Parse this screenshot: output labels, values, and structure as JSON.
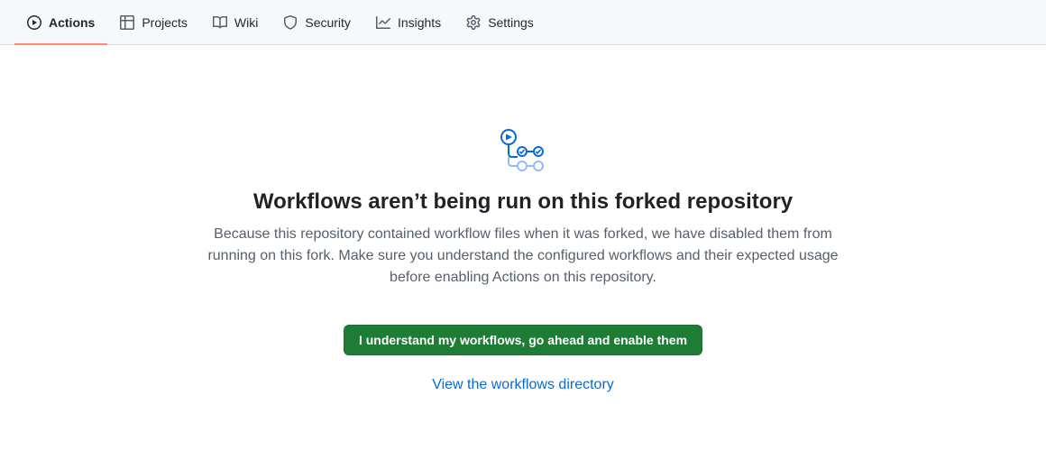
{
  "tabs": [
    {
      "id": "actions",
      "label": "Actions",
      "icon": "play-circle-icon",
      "selected": true
    },
    {
      "id": "projects",
      "label": "Projects",
      "icon": "table-icon"
    },
    {
      "id": "wiki",
      "label": "Wiki",
      "icon": "book-icon"
    },
    {
      "id": "security",
      "label": "Security",
      "icon": "shield-icon"
    },
    {
      "id": "insights",
      "label": "Insights",
      "icon": "graph-icon"
    },
    {
      "id": "settings",
      "label": "Settings",
      "icon": "gear-icon"
    }
  ],
  "blankslate": {
    "headline": "Workflows aren’t being run on this forked repository",
    "subtext": "Because this repository contained workflow files when it was forked, we have disabled them from running on this fork. Make sure you understand the configured workflows and their expected usage before enabling Actions on this repository.",
    "button_label": "I understand my workflows, go ahead and enable them",
    "link_label": "View the workflows directory"
  },
  "colors": {
    "accent_underline": "#fd8c73",
    "primary_button": "#1f7c37",
    "link": "#0969da"
  }
}
